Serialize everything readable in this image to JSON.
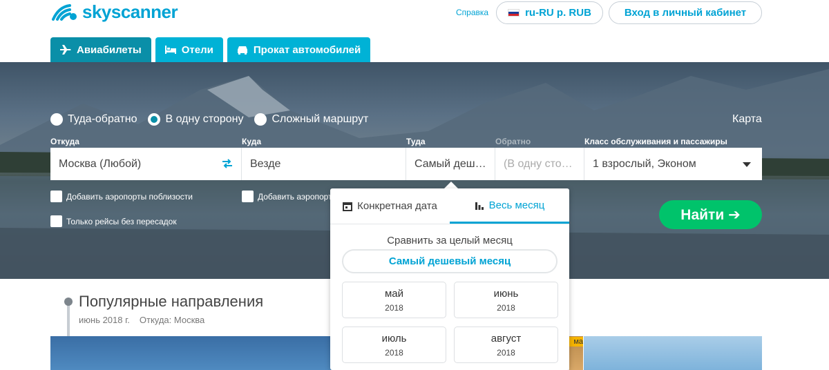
{
  "header": {
    "logo_text": "skyscanner",
    "help_link": "Справка",
    "locale_button": "ru-RU р. RUB",
    "login_button": "Вход в личный кабинет"
  },
  "tabs": [
    {
      "label": "Авиабилеты",
      "icon": "plane-icon",
      "active": true
    },
    {
      "label": "Отели",
      "icon": "bed-icon",
      "active": false
    },
    {
      "label": "Прокат автомобилей",
      "icon": "car-icon",
      "active": false
    }
  ],
  "search": {
    "trip_types": [
      {
        "label": "Туда-обратно",
        "checked": false
      },
      {
        "label": "В одну сторону",
        "checked": true
      },
      {
        "label": "Сложный маршрут",
        "checked": false
      }
    ],
    "map_link": "Карта",
    "labels": {
      "from": "Откуда",
      "to": "Куда",
      "depart": "Туда",
      "return": "Обратно",
      "cabin": "Класс обслуживания и пассажиры"
    },
    "from_value": "Москва (Любой)",
    "to_value": "Везде",
    "depart_value": "Самый деш…",
    "return_placeholder": "(В одну сто…",
    "cabin_value": "1 взрослый, Эконом",
    "nearby_origin": "Добавить аэропорты поблизости",
    "nearby_dest": "Добавить аэропорт",
    "direct_only": "Только рейсы без пересадок",
    "find_button": "Найти ➔"
  },
  "popover": {
    "tab_specific": "Конкретная дата",
    "tab_whole_month": "Весь месяц",
    "compare_label": "Сравнить за целый месяц",
    "cheapest_button": "Самый дешевый месяц",
    "months": [
      {
        "name": "май",
        "year": "2018"
      },
      {
        "name": "июнь",
        "year": "2018"
      },
      {
        "name": "июль",
        "year": "2018"
      },
      {
        "name": "август",
        "year": "2018"
      }
    ]
  },
  "popular": {
    "title": "Популярные направления",
    "period": "июнь 2018 г.",
    "origin": "Откуда: Москва",
    "card_tag": "ма"
  },
  "colors": {
    "brand": "#00a3d4",
    "tab_active": "#0a8fa8",
    "find_button": "#00c36b"
  }
}
